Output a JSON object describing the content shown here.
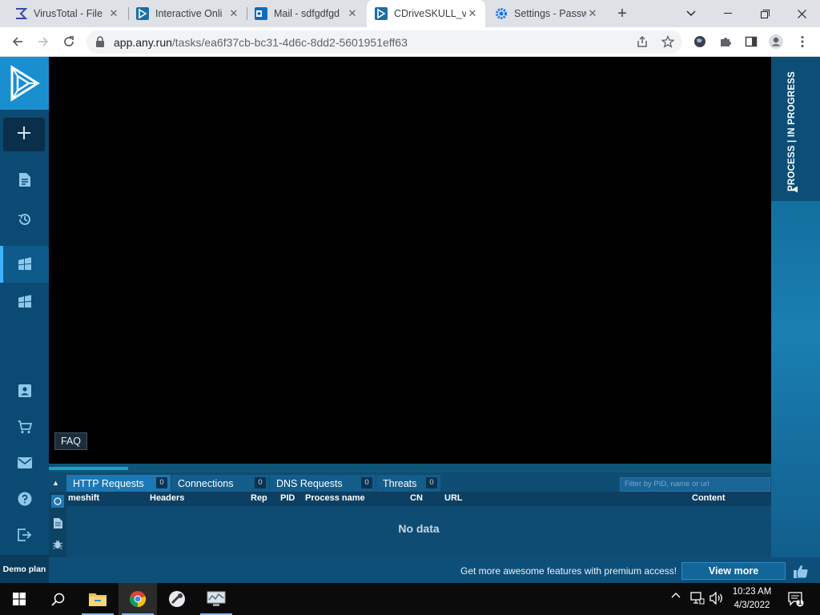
{
  "browser": {
    "tabs": [
      {
        "title": "VirusTotal - File",
        "icon": "virustotal-icon"
      },
      {
        "title": "Interactive Onli",
        "icon": "anyrun-icon"
      },
      {
        "title": "Mail - sdfgdfgd",
        "icon": "outlook-icon"
      },
      {
        "title": "CDriveSKULL_v",
        "icon": "anyrun-icon",
        "active": true
      },
      {
        "title": "Settings - Passw",
        "icon": "settings-gear-icon"
      }
    ],
    "close_glyph": "✕",
    "new_tab_glyph": "+",
    "url_host": "app.any.run",
    "url_path": "/tasks/ea6f37cb-bc31-4d6c-8dd2-5601951eff63"
  },
  "app": {
    "plan_label": "Demo plan",
    "process_label": "PROCESS | IN PROGRESS",
    "progress_fraction": 0.11,
    "tabs": [
      {
        "label": "HTTP Requests",
        "count": "0"
      },
      {
        "label": "Connections",
        "count": "0"
      },
      {
        "label": "DNS Requests",
        "count": "0"
      },
      {
        "label": "Threats",
        "count": "0"
      }
    ],
    "filter_placeholder": "Filter by PID, name or url",
    "columns": [
      "meshift",
      "Headers",
      "Rep",
      "PID",
      "Process name",
      "CN",
      "URL",
      "Content"
    ],
    "no_data": "No data",
    "faq_tooltip": "FAQ",
    "promo_text": "Get more awesome features with premium access!",
    "view_more": "View more",
    "accent_color": "#1a8fcf"
  },
  "taskbar": {
    "time": "10:23 AM",
    "date": "4/3/2022",
    "notification_count": "1"
  }
}
